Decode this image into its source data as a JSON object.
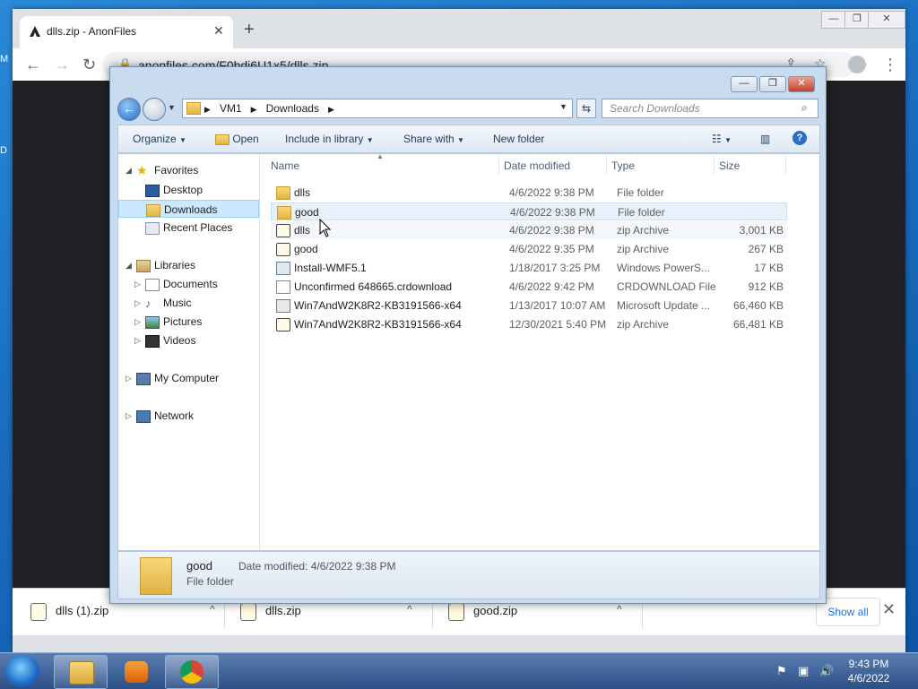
{
  "browser": {
    "tab_title": "dlls.zip - AnonFiles",
    "tab_close": "✕",
    "new_tab": "+",
    "url": "anonfiles.com/F0bdi6U1x5/dlls.zip",
    "window_controls": [
      "—",
      "❐",
      "✕"
    ]
  },
  "desktop_strip": [
    "M",
    "D"
  ],
  "downloads_bar": {
    "items": [
      {
        "name": "dlls (1).zip"
      },
      {
        "name": "dlls.zip"
      },
      {
        "name": "good.zip"
      }
    ],
    "show_all": "Show all",
    "close": "✕",
    "chevron": "^"
  },
  "explorer": {
    "window_controls": [
      "—",
      "❐",
      "✕"
    ],
    "breadcrumb": [
      "VM1",
      "Downloads"
    ],
    "search_placeholder": "Search Downloads",
    "commands": [
      "Organize",
      "Open",
      "Include in library",
      "Share with",
      "New folder"
    ],
    "columns": [
      "Name",
      "Date modified",
      "Type",
      "Size"
    ],
    "nav": {
      "favorites": {
        "label": "Favorites",
        "items": [
          "Desktop",
          "Downloads",
          "Recent Places"
        ]
      },
      "libraries": {
        "label": "Libraries",
        "items": [
          "Documents",
          "Music",
          "Pictures",
          "Videos"
        ]
      },
      "computer": "My Computer",
      "network": "Network"
    },
    "files": [
      {
        "name": "dlls",
        "date": "4/6/2022 9:38 PM",
        "type": "File folder",
        "size": "",
        "icon": "folder"
      },
      {
        "name": "good",
        "date": "4/6/2022 9:38 PM",
        "type": "File folder",
        "size": "",
        "icon": "folder"
      },
      {
        "name": "dlls",
        "date": "4/6/2022 9:38 PM",
        "type": "zip Archive",
        "size": "3,001 KB",
        "icon": "zip"
      },
      {
        "name": "good",
        "date": "4/6/2022 9:35 PM",
        "type": "zip Archive",
        "size": "267 KB",
        "icon": "zip"
      },
      {
        "name": "Install-WMF5.1",
        "date": "1/18/2017 3:25 PM",
        "type": "Windows PowerS...",
        "size": "17 KB",
        "icon": "ps"
      },
      {
        "name": "Unconfirmed 648665.crdownload",
        "date": "4/6/2022 9:42 PM",
        "type": "CRDOWNLOAD File",
        "size": "912 KB",
        "icon": "doc"
      },
      {
        "name": "Win7AndW2K8R2-KB3191566-x64",
        "date": "1/13/2017 10:07 AM",
        "type": "Microsoft Update ...",
        "size": "66,460 KB",
        "icon": "msu"
      },
      {
        "name": "Win7AndW2K8R2-KB3191566-x64",
        "date": "12/30/2021 5:40 PM",
        "type": "zip Archive",
        "size": "66,481 KB",
        "icon": "zip"
      }
    ],
    "details": {
      "name": "good",
      "type": "File folder",
      "date_modified_label": "Date modified:",
      "date_modified": "4/6/2022 9:38 PM"
    }
  },
  "taskbar": {
    "time": "9:43 PM",
    "date": "4/6/2022"
  }
}
